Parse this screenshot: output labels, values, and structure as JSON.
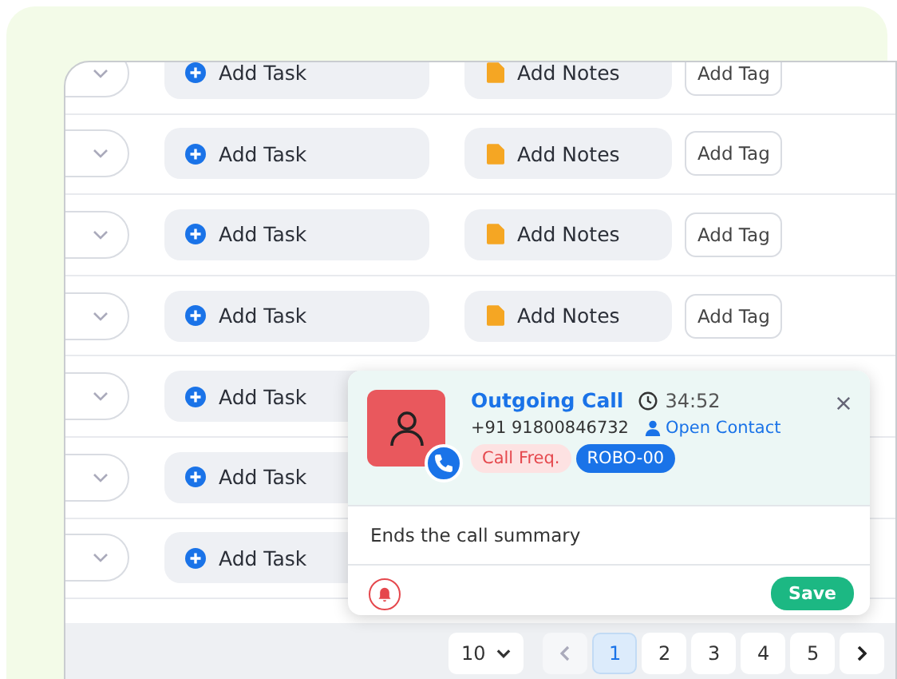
{
  "rows": [
    {
      "task": "Add Task",
      "notes": "Add Notes",
      "tag": "Add Tag"
    },
    {
      "task": "Add Task",
      "notes": "Add Notes",
      "tag": "Add Tag"
    },
    {
      "task": "Add Task",
      "notes": "Add Notes",
      "tag": "Add Tag"
    },
    {
      "task": "Add Task",
      "notes": "Add Notes",
      "tag": "Add Tag"
    },
    {
      "task": "Add Task"
    },
    {
      "task": "Add Task"
    },
    {
      "task": "Add Task"
    }
  ],
  "call_popup": {
    "title": "Outgoing Call",
    "duration": "34:52",
    "phone": "+91 91800846732",
    "open_contact": "Open Contact",
    "tags": [
      {
        "label": "Call Freq.",
        "color": "#fde2e2"
      },
      {
        "label": "ROBO-00",
        "color": "#1a73e8"
      }
    ],
    "summary": "Ends the call summary",
    "save": "Save"
  },
  "pagination": {
    "page_size": "10",
    "pages": [
      {
        "label": "1",
        "selected": true
      },
      {
        "label": "2",
        "selected": false
      },
      {
        "label": "3",
        "selected": false
      },
      {
        "label": "4",
        "selected": false
      },
      {
        "label": "5",
        "selected": false
      }
    ]
  }
}
